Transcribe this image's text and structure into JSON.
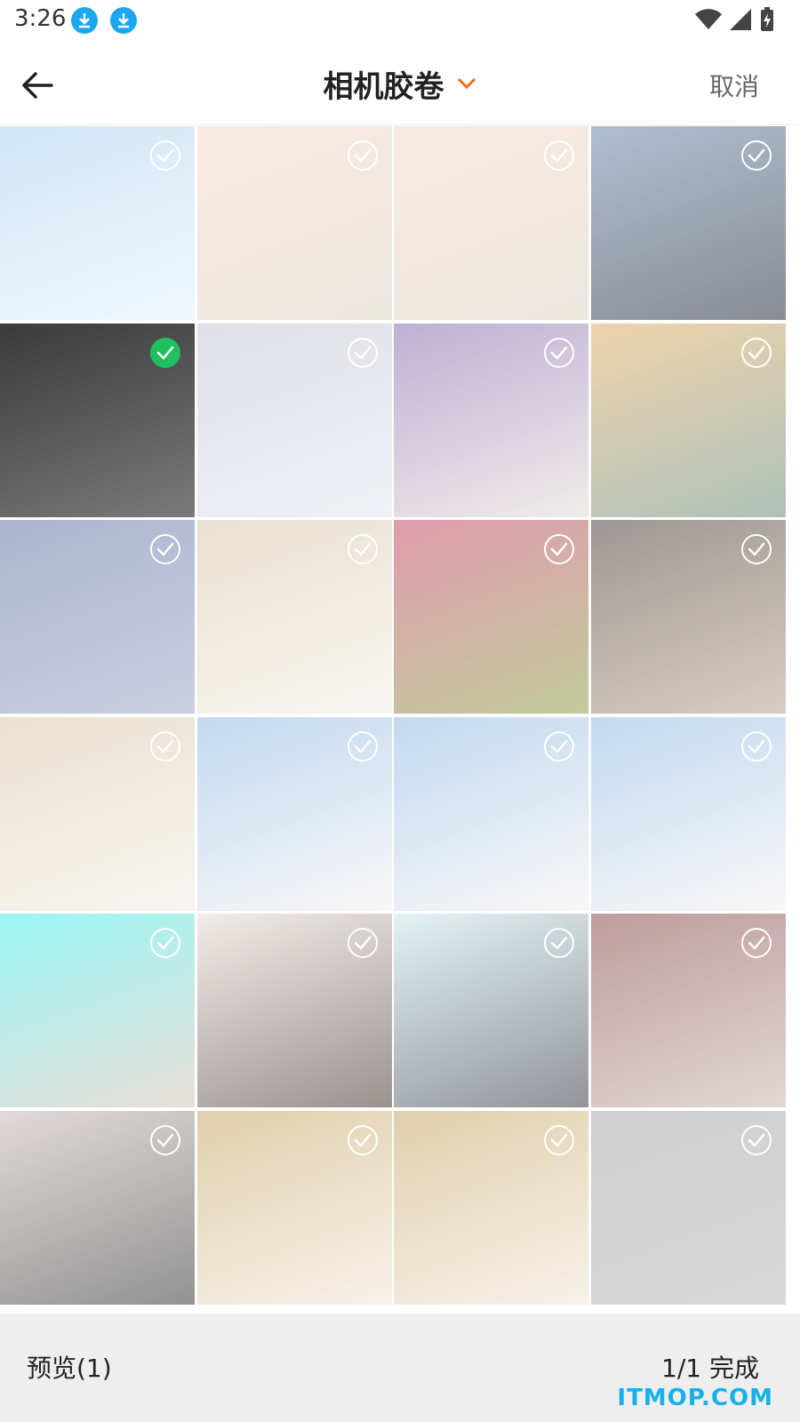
{
  "status_bar": {
    "time": "3:26"
  },
  "header": {
    "title": "相机胶卷",
    "cancel_label": "取消"
  },
  "grid": {
    "columns": 4,
    "selected_index": 4,
    "items": [
      {
        "name": "sky-clouds",
        "colors": [
          "#a9d0ee",
          "#e6f1fa"
        ]
      },
      {
        "name": "pink-rose",
        "colors": [
          "#f4d9c9",
          "#d9d3c5"
        ]
      },
      {
        "name": "pink-rose-2",
        "colors": [
          "#f4d9c9",
          "#d9d3c5"
        ]
      },
      {
        "name": "girl-skiing",
        "colors": [
          "#6f89ad",
          "#2a2f3b"
        ]
      },
      {
        "name": "concrete-facade",
        "colors": [
          "#3a3a3a",
          "#7a7a7a"
        ]
      },
      {
        "name": "moon-window",
        "colors": [
          "#c3c6d0",
          "#e3e6f0"
        ]
      },
      {
        "name": "woman-purple-dress",
        "colors": [
          "#8a6fb0",
          "#e4dcd8"
        ]
      },
      {
        "name": "mountain-lake",
        "colors": [
          "#e2b06a",
          "#6e8f7f"
        ]
      },
      {
        "name": "invitation-card",
        "colors": [
          "#6a76a8",
          "#a1a8c9"
        ]
      },
      {
        "name": "girl-white-shirt",
        "colors": [
          "#d8c8a8",
          "#f1eee8"
        ]
      },
      {
        "name": "red-roses",
        "colors": [
          "#c64a6a",
          "#8ea04a"
        ]
      },
      {
        "name": "couple-drama",
        "colors": [
          "#4d4440",
          "#b8a58d"
        ]
      },
      {
        "name": "girl-white-shirt-2",
        "colors": [
          "#d8c8a8",
          "#f1eee8"
        ]
      },
      {
        "name": "girl-blue-bg",
        "colors": [
          "#8fbae6",
          "#f4f0ef"
        ]
      },
      {
        "name": "girl-blue-bg-2",
        "colors": [
          "#8fbae6",
          "#f4f0ef"
        ]
      },
      {
        "name": "girl-blue-bg-3",
        "colors": [
          "#8fbae6",
          "#f4f0ef"
        ]
      },
      {
        "name": "collage-flowers",
        "colors": [
          "#48f0ee",
          "#d6c3b6"
        ]
      },
      {
        "name": "girl-black-dress",
        "colors": [
          "#e7dcd6",
          "#4a3a36"
        ]
      },
      {
        "name": "cosplay-suit",
        "colors": [
          "#cfe8ee",
          "#3a3e48"
        ]
      },
      {
        "name": "girl-back",
        "colors": [
          "#8a4a4e",
          "#c8b8b2"
        ]
      },
      {
        "name": "girl-portrait",
        "colors": [
          "#c8bdb8",
          "#3a3a3a"
        ]
      },
      {
        "name": "vase-book",
        "colors": [
          "#c8a86a",
          "#f0e6d4"
        ]
      },
      {
        "name": "vase-book-2",
        "colors": [
          "#c8a86a",
          "#f0e6d4"
        ]
      },
      {
        "name": "gray-blank",
        "colors": [
          "#a8a8a8",
          "#b8b8b8"
        ]
      }
    ]
  },
  "bottom_bar": {
    "preview_label": "预览(1)",
    "done_label": "1/1 完成"
  },
  "watermark": "ITMOP.COM",
  "colors": {
    "accent": "#f26a1b",
    "check_selected": "#20c060",
    "watermark": "#16b0ea"
  }
}
